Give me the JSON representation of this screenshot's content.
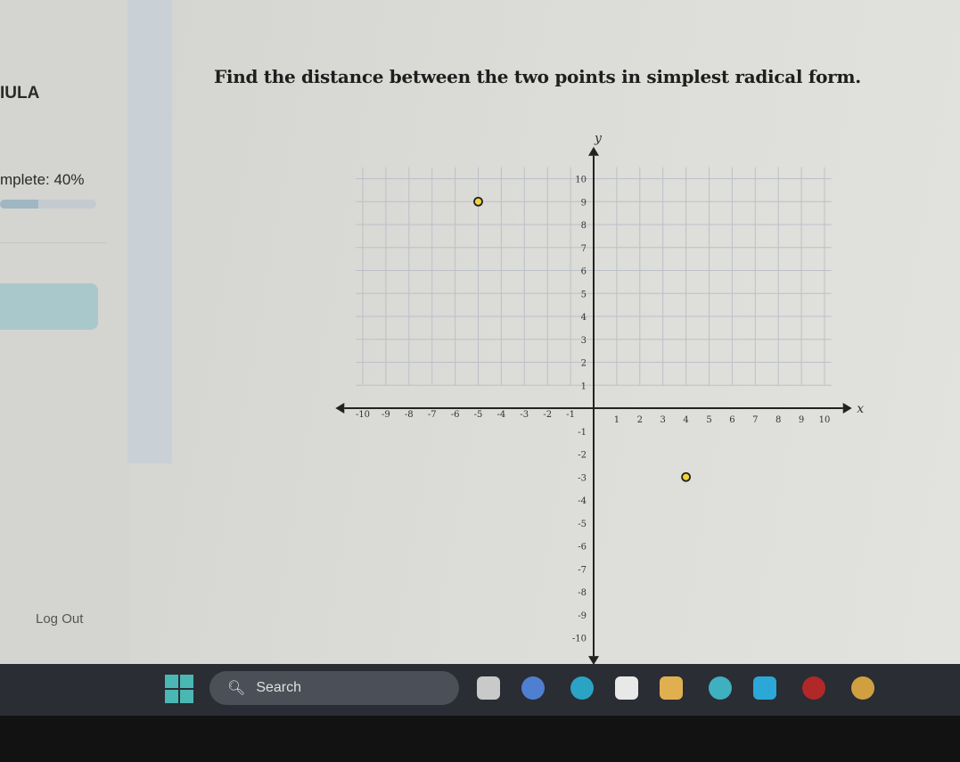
{
  "sidebar": {
    "brand": "IULA",
    "progress_label": "mplete: 40%",
    "progress_percent": 40,
    "logout_label": "Log Out"
  },
  "question": "Find the distance between the two points in simplest radical form.",
  "taskbar": {
    "search_label": "Search",
    "icons": [
      "windows-start-icon",
      "task-view-icon",
      "chat-icon",
      "edge-icon",
      "store-icon",
      "file-explorer-icon",
      "app-icon",
      "app-icon",
      "app-icon",
      "app-icon"
    ]
  },
  "chart_data": {
    "type": "scatter",
    "xlabel": "x",
    "ylabel": "y",
    "xlim": [
      -10,
      10
    ],
    "ylim": [
      -10,
      10
    ],
    "grid": true,
    "x_ticks": [
      "-10",
      "-9",
      "-8",
      "-7",
      "-6",
      "-5",
      "-4",
      "-3",
      "-2",
      "-1",
      "1",
      "2",
      "3",
      "4",
      "5",
      "6",
      "7",
      "8",
      "9",
      "10"
    ],
    "y_ticks": [
      "10",
      "9",
      "8",
      "7",
      "6",
      "5",
      "4",
      "3",
      "2",
      "1",
      "-1",
      "-2",
      "-3",
      "-4",
      "-5",
      "-6",
      "-7",
      "-8",
      "-9",
      "-10"
    ],
    "points": [
      {
        "x": -5,
        "y": 9
      },
      {
        "x": 4,
        "y": -3
      }
    ],
    "point_color": "#f2d43a"
  }
}
